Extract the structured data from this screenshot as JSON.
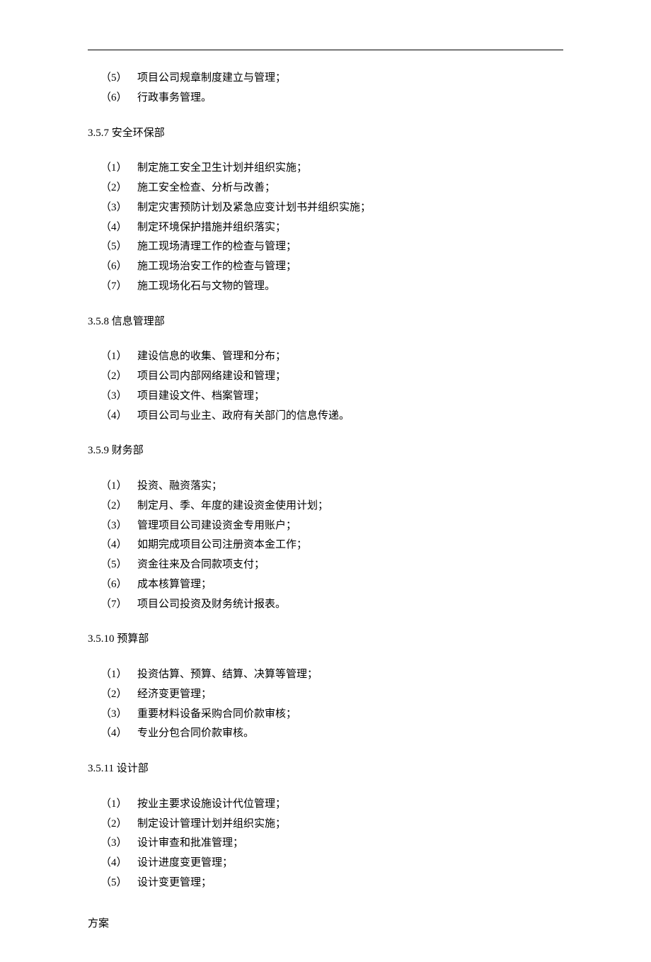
{
  "continued_items": [
    {
      "num": "（5）",
      "text": "项目公司规章制度建立与管理；"
    },
    {
      "num": "（6）",
      "text": "行政事务管理。"
    }
  ],
  "sections": [
    {
      "heading": "3.5.7  安全环保部",
      "items": [
        {
          "num": "（1）",
          "text": "制定施工安全卫生计划并组织实施；"
        },
        {
          "num": "（2）",
          "text": "施工安全检查、分析与改善；"
        },
        {
          "num": "（3）",
          "text": "制定灾害预防计划及紧急应变计划书并组织实施；"
        },
        {
          "num": "（4）",
          "text": "制定环境保护措施并组织落实；"
        },
        {
          "num": "（5）",
          "text": "施工现场清理工作的检查与管理；"
        },
        {
          "num": "（6）",
          "text": "施工现场治安工作的检查与管理；"
        },
        {
          "num": "（7）",
          "text": "施工现场化石与文物的管理。"
        }
      ]
    },
    {
      "heading": "3.5.8  信息管理部",
      "items": [
        {
          "num": "（1）",
          "text": "建设信息的收集、管理和分布；"
        },
        {
          "num": "（2）",
          "text": "项目公司内部网络建设和管理；"
        },
        {
          "num": "（3）",
          "text": "项目建设文件、档案管理；"
        },
        {
          "num": "（4）",
          "text": "项目公司与业主、政府有关部门的信息传递。"
        }
      ]
    },
    {
      "heading": "3.5.9 财务部",
      "items": [
        {
          "num": "（1）",
          "text": "投资、融资落实；"
        },
        {
          "num": "（2）",
          "text": "制定月、季、年度的建设资金使用计划；"
        },
        {
          "num": "（3）",
          "text": "管理项目公司建设资金专用账户；"
        },
        {
          "num": "（4）",
          "text": "如期完成项目公司注册资本金工作；"
        },
        {
          "num": "（5）",
          "text": "资金往来及合同款项支付；"
        },
        {
          "num": "（6）",
          "text": "成本核算管理；"
        },
        {
          "num": "（7）",
          "text": "项目公司投资及财务统计报表。"
        }
      ]
    },
    {
      "heading": "3.5.10  预算部",
      "items": [
        {
          "num": "（1）",
          "text": "投资估算、预算、结算、决算等管理；"
        },
        {
          "num": "（2）",
          "text": "经济变更管理；"
        },
        {
          "num": "（3）",
          "text": "重要材料设备采购合同价款审核；"
        },
        {
          "num": "（4）",
          "text": "专业分包合同价款审核。"
        }
      ]
    },
    {
      "heading": "3.5.11  设计部",
      "items": [
        {
          "num": "（1）",
          "text": "按业主要求设施设计代位管理；"
        },
        {
          "num": "（2）",
          "text": "制定设计管理计划并组织实施；"
        },
        {
          "num": "（3）",
          "text": "设计审查和批准管理；"
        },
        {
          "num": "（4）",
          "text": "设计进度变更管理；"
        },
        {
          "num": "（5）",
          "text": "设计变更管理；"
        }
      ]
    }
  ],
  "footer": "方案"
}
